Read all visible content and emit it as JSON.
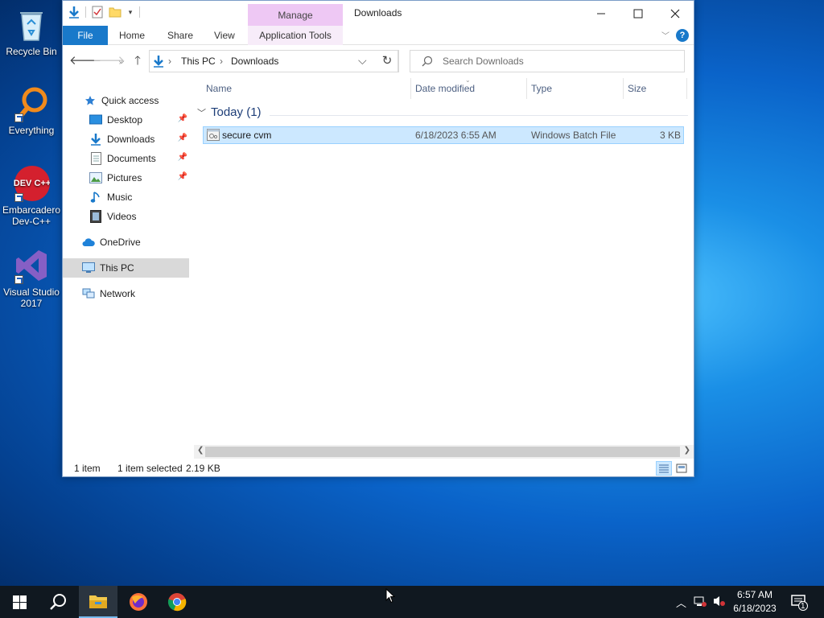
{
  "desktop": {
    "icons": [
      {
        "label": "Recycle Bin"
      },
      {
        "label": "Everything"
      },
      {
        "label": "Embarcadero Dev-C++"
      },
      {
        "label": "Visual Studio 2017"
      }
    ],
    "devcpp_logo_text": "DEV C++"
  },
  "window": {
    "title": "Downloads",
    "manage_label": "Manage",
    "app_tools_label": "Application Tools",
    "ribbon_tabs": {
      "file": "File",
      "home": "Home",
      "share": "Share",
      "view": "View"
    },
    "address": {
      "segments": [
        "This PC",
        "Downloads"
      ]
    },
    "search": {
      "placeholder": "Search Downloads"
    }
  },
  "navpane": {
    "quick_access": "Quick access",
    "pinned": [
      "Desktop",
      "Downloads",
      "Documents",
      "Pictures"
    ],
    "items": [
      "Music",
      "Videos"
    ],
    "onedrive": "OneDrive",
    "this_pc": "This PC",
    "network": "Network"
  },
  "columns": {
    "name": "Name",
    "date": "Date modified",
    "type": "Type",
    "size": "Size"
  },
  "group": {
    "label": "Today (1)"
  },
  "files": [
    {
      "name": "secure cvm",
      "date": "6/18/2023 6:55 AM",
      "type": "Windows Batch File",
      "size": "3 KB"
    }
  ],
  "status": {
    "count": "1 item",
    "selected": "1 item selected",
    "size": "2.19 KB"
  },
  "taskbar": {
    "apps": [
      "start-icon",
      "search-icon",
      "file-explorer-icon",
      "firefox-icon",
      "chrome-icon"
    ],
    "time": "6:57 AM",
    "date": "6/18/2023",
    "notification_count": "1"
  },
  "colors": {
    "accent": "#1979ca",
    "selection": "#cce8ff",
    "manage": "#eec8f4"
  }
}
